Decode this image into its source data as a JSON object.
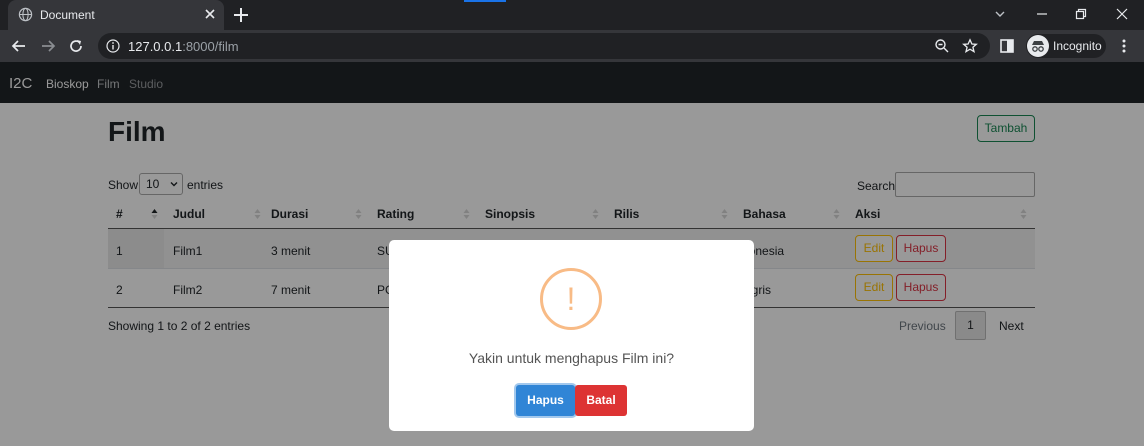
{
  "browser": {
    "tab_title": "Document",
    "url_host": "127.0.0.1",
    "url_rest": ":8000/film",
    "profile_label": "Incognito"
  },
  "navbar": {
    "brand": "I2C",
    "links": [
      "Bioskop",
      "Film",
      "Studio"
    ]
  },
  "page": {
    "title": "Film",
    "add_button": "Tambah",
    "show_label": "Show",
    "entries_value": "10",
    "entries_label": "entries",
    "search_label": "Search:"
  },
  "table": {
    "columns": [
      "#",
      "Judul",
      "Durasi",
      "Rating",
      "Sinopsis",
      "Rilis",
      "Bahasa",
      "Aksi"
    ],
    "rows": [
      {
        "no": "1",
        "judul": "Film1",
        "durasi": "3 menit",
        "rating": "SU",
        "bahasa": "donesia",
        "edit": "Edit",
        "hapus": "Hapus"
      },
      {
        "no": "2",
        "judul": "Film2",
        "durasi": "7 menit",
        "rating": "PG",
        "bahasa": "ggris",
        "edit": "Edit",
        "hapus": "Hapus"
      }
    ],
    "info": "Showing 1 to 2 of 2 entries",
    "pagination": {
      "previous": "Previous",
      "current": "1",
      "next": "Next"
    }
  },
  "modal": {
    "icon_text": "!",
    "message": "Yakin untuk menghapus Film ini?",
    "confirm_label": "Hapus",
    "cancel_label": "Batal"
  },
  "colors": {
    "warning_icon": "#f8bb86",
    "confirm": "#3085d6",
    "cancel": "#dd3333",
    "navbar": "#212529",
    "success": "#198754",
    "edit": "#ffc107",
    "delete": "#dc3545"
  },
  "icons": [
    "globe-icon",
    "close-icon",
    "plus-icon",
    "back-icon",
    "forward-icon",
    "reload-icon",
    "info-icon",
    "zoom-icon",
    "star-icon",
    "side-panel-icon",
    "incognito-icon",
    "more-icon",
    "sort-icon",
    "chevron-down-icon",
    "warning-icon"
  ]
}
